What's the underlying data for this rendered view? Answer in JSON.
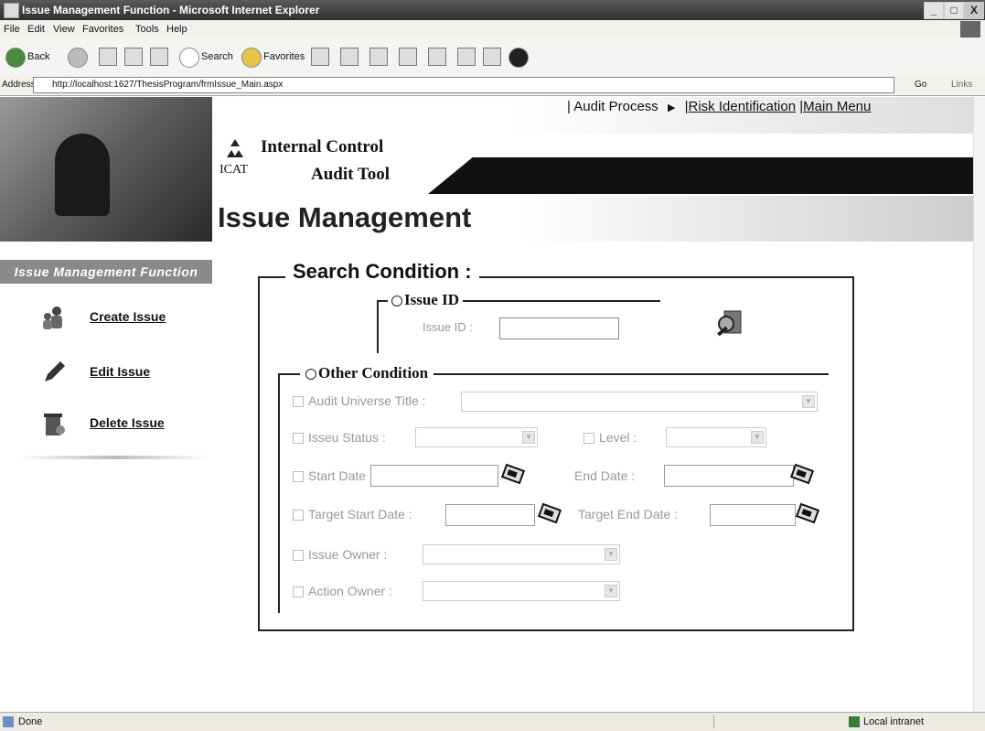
{
  "window": {
    "title": "Issue Management Function - Microsoft Internet Explorer",
    "controls": [
      "_",
      "□",
      "X"
    ]
  },
  "menu": [
    "File",
    "Edit",
    "View",
    "Favorites",
    "Tools",
    "Help"
  ],
  "toolbar": {
    "back": "Back",
    "search": "Search",
    "favorites": "Favorites"
  },
  "address": {
    "label": "Address",
    "url": "http://localhost:1627/ThesisProgram/frmIssue_Main.aspx",
    "go": "Go",
    "links": "Links"
  },
  "header": {
    "logo_text": "ICAT",
    "title_line1": "Internal Control",
    "title_line2": "Audit Tool",
    "nav_sep1": "|",
    "nav_audit": "Audit Process",
    "nav_arrow": "▶",
    "nav_risk": "Risk Identification",
    "nav_main": "Main Menu",
    "page_title": "Issue Management"
  },
  "sidebar": {
    "heading": "Issue Management Function",
    "items": [
      {
        "label": "Create Issue",
        "icon": "people-icon"
      },
      {
        "label": "Edit Issue",
        "icon": "pencil-icon"
      },
      {
        "label": "Delete Issue",
        "icon": "trash-icon"
      }
    ]
  },
  "search": {
    "legend": "Search Condition :",
    "issue_id_legend": "Issue ID",
    "issue_id_label": "Issue ID :",
    "issue_id_value": "",
    "other_legend": "Other Condition",
    "audit_universe_label": "Audit Universe Title :",
    "issue_status_label": "Isseu Status :",
    "level_label": "Level :",
    "start_date_label": "Start Date :",
    "end_date_label": "End Date :",
    "target_start_label": "Target Start Date :",
    "target_end_label": "Target End Date :",
    "issue_owner_label": "Issue Owner :",
    "action_owner_label": "Action Owner :"
  },
  "status": {
    "left": "Done",
    "zone": "Local intranet"
  }
}
